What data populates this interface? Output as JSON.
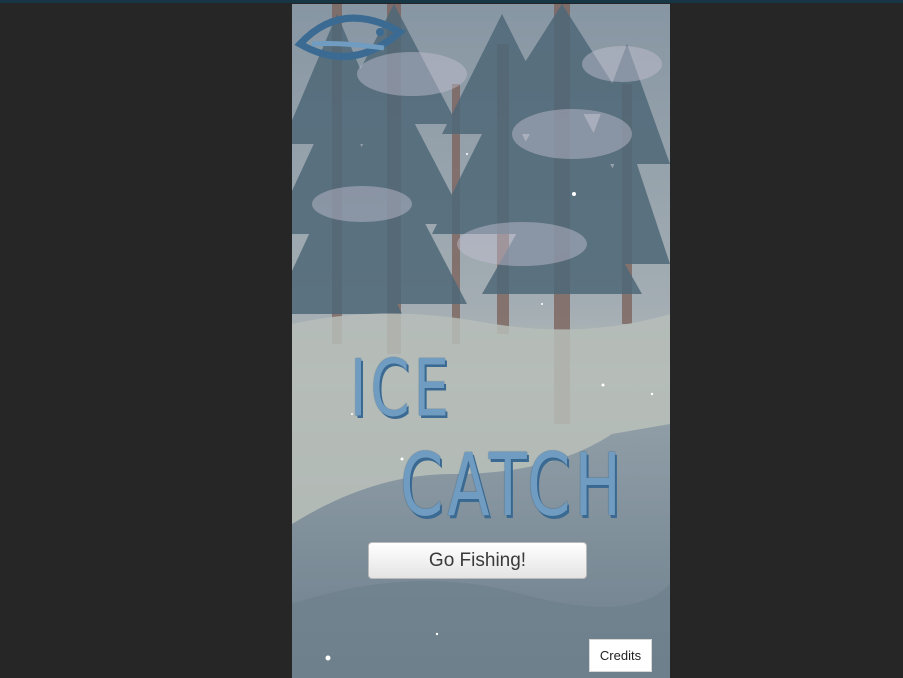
{
  "game": {
    "title_line1": "ICE",
    "title_line2": "CATCH",
    "go_fishing_label": "Go Fishing!",
    "credits_label": "Credits"
  },
  "colors": {
    "page_background": "#262626",
    "top_bar": "#163545",
    "logo_blue": "#6f9cc0",
    "logo_dark_blue": "#2f5a80",
    "button_background": "#ffffff"
  },
  "icons": {
    "logo_fish": "fish-icon"
  }
}
